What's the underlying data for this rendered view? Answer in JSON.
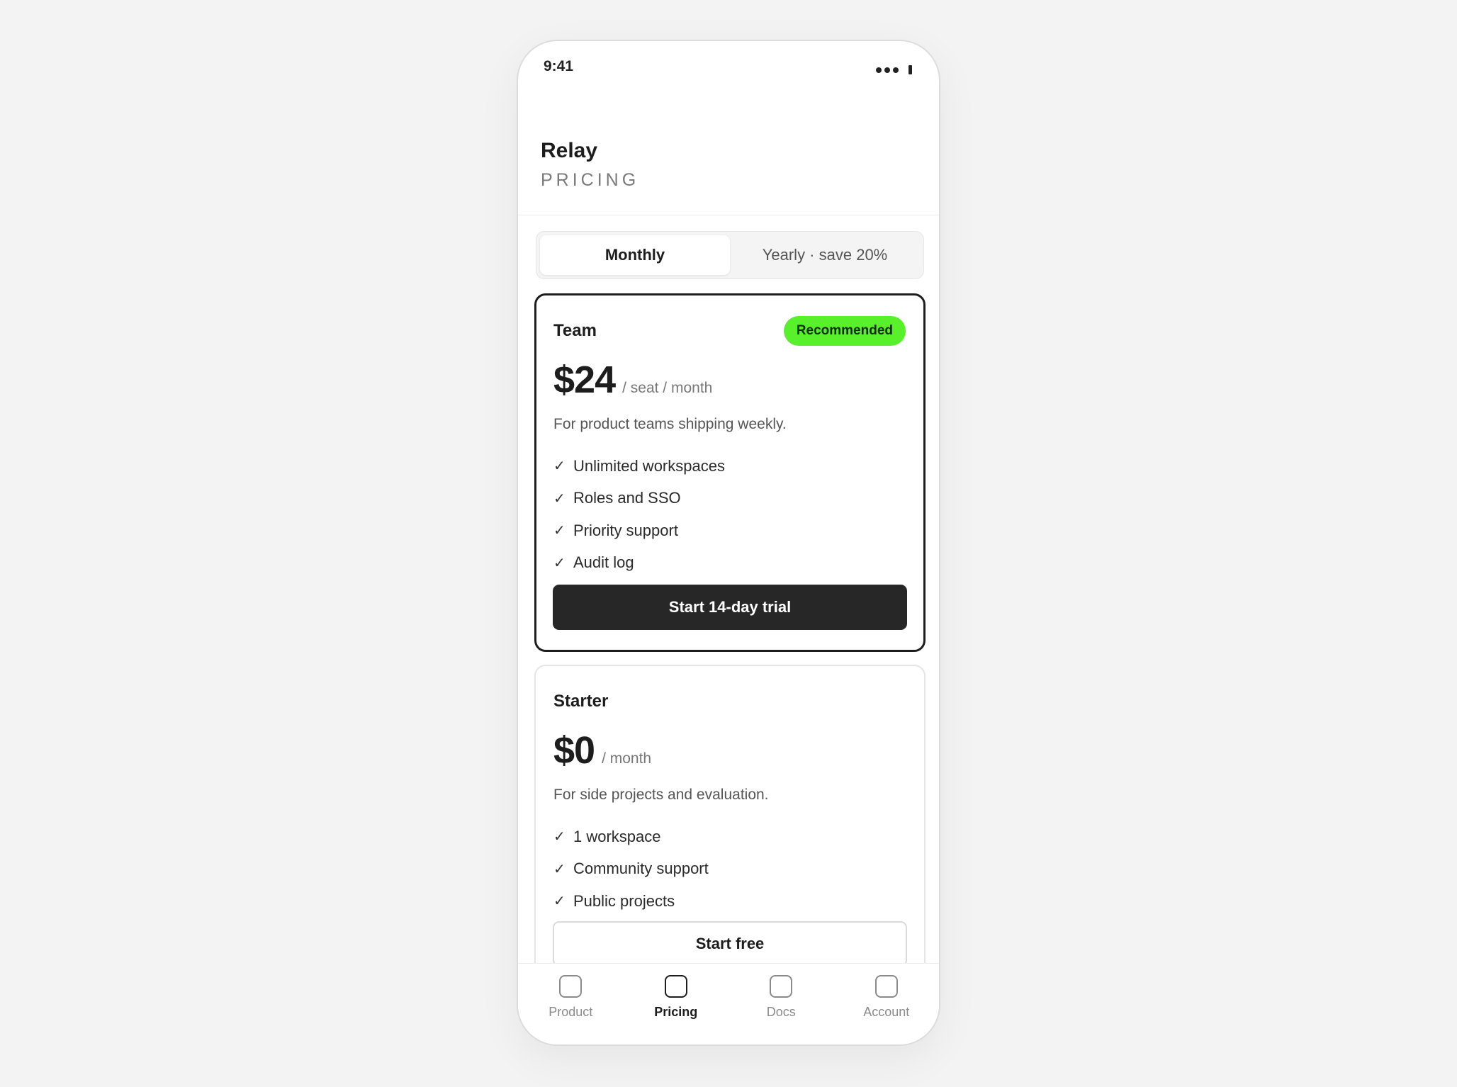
{
  "status_bar": {
    "time": "9:41"
  },
  "header": {
    "app_title": "Relay",
    "page_label": "PRICING"
  },
  "billing_toggle": {
    "options": [
      "Monthly",
      "Yearly · save 20%"
    ],
    "selected": "Monthly"
  },
  "plans": [
    {
      "name": "Team",
      "badge": "Recommended",
      "price": "$24",
      "price_unit": "/ seat / month",
      "description": "For product teams shipping weekly.",
      "features": [
        "Unlimited workspaces",
        "Roles and SSO",
        "Priority support",
        "Audit log"
      ],
      "cta": "Start 14-day trial"
    },
    {
      "name": "Starter",
      "price": "$0",
      "price_unit": "/ month",
      "description": "For side projects and evaluation.",
      "features": [
        "1 workspace",
        "Community support",
        "Public projects"
      ],
      "cta": "Start free"
    }
  ],
  "check_glyph": "✓",
  "tab_bar": {
    "items": [
      "Product",
      "Pricing",
      "Docs",
      "Account"
    ],
    "active": "Pricing"
  },
  "colors": {
    "accent_badge": "#58f02a",
    "primary_button": "#272727",
    "background": "#f3f3f3"
  }
}
